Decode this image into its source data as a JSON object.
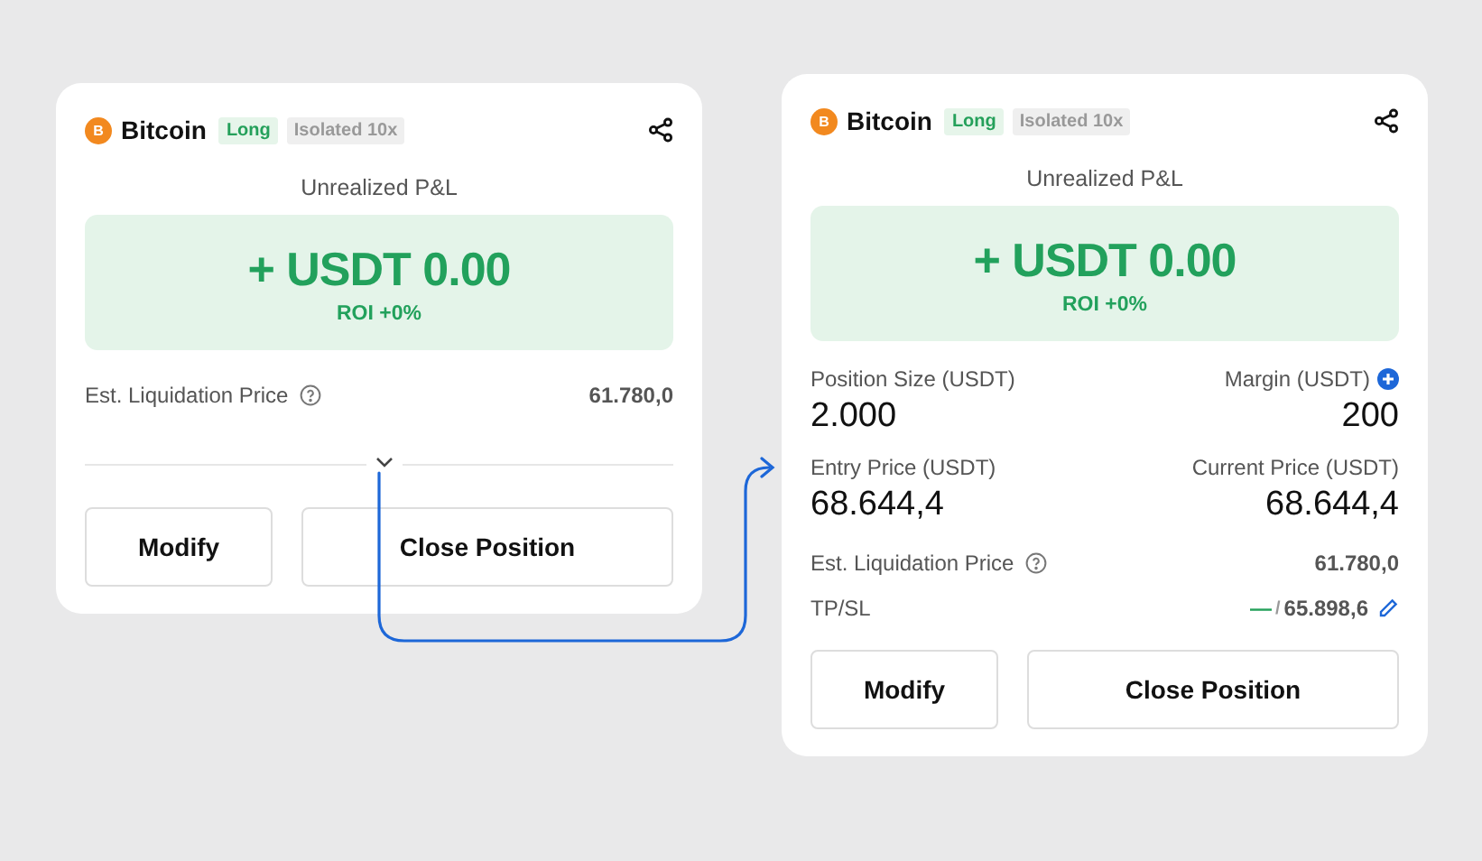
{
  "cards": [
    {
      "kind": "collapsed",
      "coin": "Bitcoin",
      "coin_glyph": "B",
      "direction": "Long",
      "margin_mode": "Isolated 10x",
      "pnl_label": "Unrealized P&L",
      "pnl_value": "+ USDT 0.00",
      "roi": "ROI +0%",
      "liquidation": {
        "label": "Est. Liquidation Price",
        "value": "61.780,0"
      },
      "buttons": [
        "Modify",
        "Close Position"
      ]
    },
    {
      "kind": "expanded",
      "coin": "Bitcoin",
      "coin_glyph": "B",
      "direction": "Long",
      "margin_mode": "Isolated 10x",
      "pnl_label": "Unrealized P&L",
      "pnl_value": "+ USDT 0.00",
      "roi": "ROI +0%",
      "stats": [
        {
          "label": "Position Size (USDT)",
          "value": "2.000"
        },
        {
          "label": "Margin (USDT)",
          "value": "200",
          "addable": true
        },
        {
          "label": "Entry Price (USDT)",
          "value": "68.644,4"
        },
        {
          "label": "Current Price (USDT)",
          "value": "68.644,4"
        }
      ],
      "liquidation": {
        "label": "Est. Liquidation Price",
        "value": "61.780,0"
      },
      "tp_sl": {
        "label": "TP/SL",
        "tp": "—",
        "separator": "/",
        "sl": "65.898,6"
      },
      "buttons": [
        "Modify",
        "Close Position"
      ]
    }
  ]
}
